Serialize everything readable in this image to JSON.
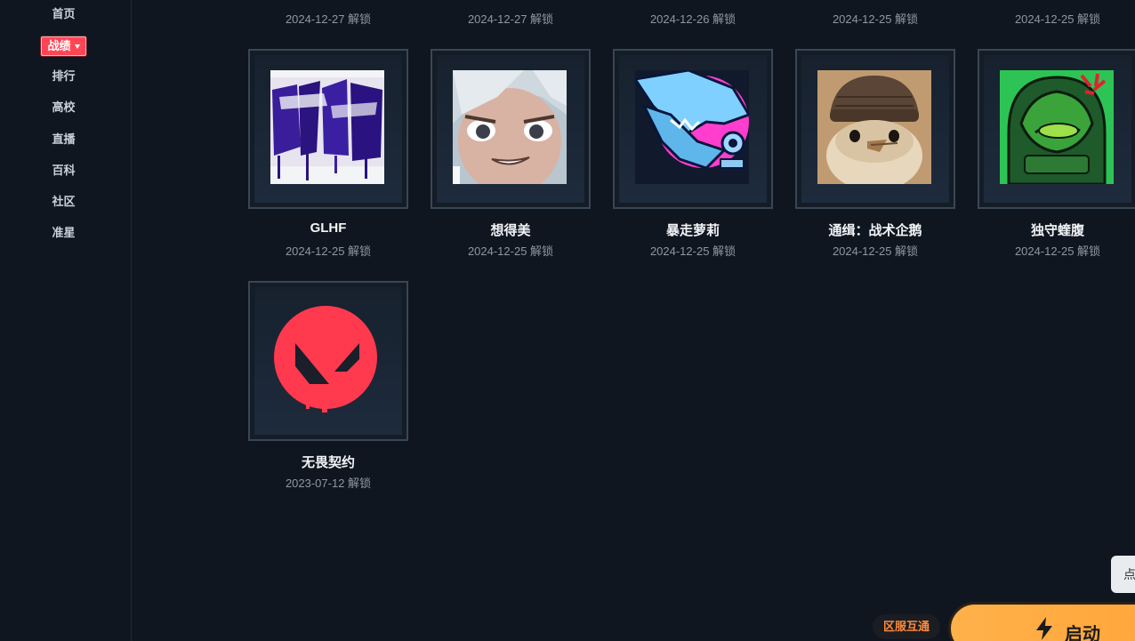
{
  "sidebar": {
    "items": [
      {
        "label": "首页"
      },
      {
        "label": "战绩",
        "active": true
      },
      {
        "label": "排行"
      },
      {
        "label": "高校"
      },
      {
        "label": "直播"
      },
      {
        "label": "百科"
      },
      {
        "label": "社区"
      },
      {
        "label": "准星"
      }
    ]
  },
  "top_row_dates": [
    "2024-12-27 解锁",
    "2024-12-27 解锁",
    "2024-12-26 解锁",
    "2024-12-25 解锁",
    "2024-12-25 解锁"
  ],
  "cards": [
    {
      "title": "GLHF",
      "date": "2024-12-25 解锁",
      "icon": "graffiti-glhf-icon"
    },
    {
      "title": "想得美",
      "date": "2024-12-25 解锁",
      "icon": "cartoon-face-icon"
    },
    {
      "title": "暴走萝莉",
      "date": "2024-12-25 解锁",
      "icon": "shark-graffiti-icon"
    },
    {
      "title": "通缉：战术企鹅",
      "date": "2024-12-25 解锁",
      "icon": "penguin-icon"
    },
    {
      "title": "独守蝰腹",
      "date": "2024-12-25 解锁",
      "icon": "green-alien-icon"
    },
    {
      "title": "无畏契约",
      "date": "2023-07-12 解锁",
      "icon": "valorant-logo-icon"
    }
  ],
  "footer": {
    "region_badge": "区服互通",
    "launch_label": "启动",
    "side_tab_label": "点"
  },
  "colors": {
    "background": "#0f1620",
    "accent_red": "#ff4655",
    "launch_orange": "#ffa63a"
  }
}
